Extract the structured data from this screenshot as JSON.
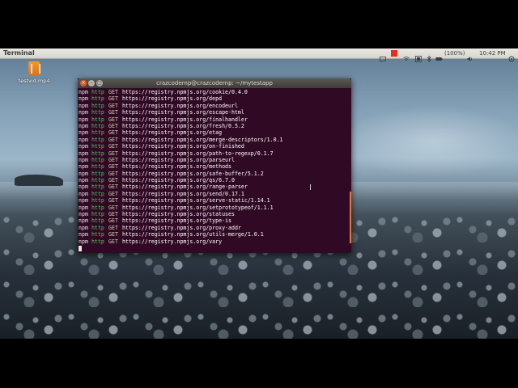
{
  "topbar": {
    "app_name": "Terminal",
    "battery": "(100%)",
    "time": "10:42 PM"
  },
  "desktop": {
    "icon_label": "testvid.mp4"
  },
  "terminal": {
    "title": "crazcodernp@crazcodernp: ~/mytestapp",
    "lines": [
      {
        "npm": "npm",
        "http": "http",
        "method": "GET",
        "url": "https://registry.npmjs.org/cookie/0.4.0"
      },
      {
        "npm": "npm",
        "http": "http",
        "method": "GET",
        "url": "https://registry.npmjs.org/depd"
      },
      {
        "npm": "npm",
        "http": "http",
        "method": "GET",
        "url": "https://registry.npmjs.org/encodeurl"
      },
      {
        "npm": "npm",
        "http": "http",
        "method": "GET",
        "url": "https://registry.npmjs.org/escape-html"
      },
      {
        "npm": "npm",
        "http": "http",
        "method": "GET",
        "url": "https://registry.npmjs.org/finalhandler"
      },
      {
        "npm": "npm",
        "http": "http",
        "method": "GET",
        "url": "https://registry.npmjs.org/fresh/0.5.2"
      },
      {
        "npm": "npm",
        "http": "http",
        "method": "GET",
        "url": "https://registry.npmjs.org/etag"
      },
      {
        "npm": "npm",
        "http": "http",
        "method": "GET",
        "url": "https://registry.npmjs.org/merge-descriptors/1.0.1"
      },
      {
        "npm": "npm",
        "http": "http",
        "method": "GET",
        "url": "https://registry.npmjs.org/on-finished"
      },
      {
        "npm": "npm",
        "http": "http",
        "method": "GET",
        "url": "https://registry.npmjs.org/path-to-regexp/0.1.7"
      },
      {
        "npm": "npm",
        "http": "http",
        "method": "GET",
        "url": "https://registry.npmjs.org/parseurl"
      },
      {
        "npm": "npm",
        "http": "http",
        "method": "GET",
        "url": "https://registry.npmjs.org/methods"
      },
      {
        "npm": "npm",
        "http": "http",
        "method": "GET",
        "url": "https://registry.npmjs.org/safe-buffer/5.1.2"
      },
      {
        "npm": "npm",
        "http": "http",
        "method": "GET",
        "url": "https://registry.npmjs.org/qs/6.7.0"
      },
      {
        "npm": "npm",
        "http": "http",
        "method": "GET",
        "url": "https://registry.npmjs.org/range-parser"
      },
      {
        "npm": "npm",
        "http": "http",
        "method": "GET",
        "url": "https://registry.npmjs.org/send/0.17.1"
      },
      {
        "npm": "npm",
        "http": "http",
        "method": "GET",
        "url": "https://registry.npmjs.org/serve-static/1.14.1"
      },
      {
        "npm": "npm",
        "http": "http",
        "method": "GET",
        "url": "https://registry.npmjs.org/setprototypeof/1.1.1"
      },
      {
        "npm": "npm",
        "http": "http",
        "method": "GET",
        "url": "https://registry.npmjs.org/statuses"
      },
      {
        "npm": "npm",
        "http": "http",
        "method": "GET",
        "url": "https://registry.npmjs.org/type-is"
      },
      {
        "npm": "npm",
        "http": "http",
        "method": "GET",
        "url": "https://registry.npmjs.org/proxy-addr"
      },
      {
        "npm": "npm",
        "http": "http",
        "method": "GET",
        "url": "https://registry.npmjs.org/utils-merge/1.0.1"
      },
      {
        "npm": "npm",
        "http": "http",
        "method": "GET",
        "url": "https://registry.npmjs.org/vary"
      }
    ]
  },
  "colors": {
    "terminal_bg": "#300a24",
    "http_green": "#4ec95f",
    "panel_bg": "#dfdbd2"
  },
  "icons": [
    "close-icon",
    "minimize-icon",
    "maximize-icon",
    "wifi-icon",
    "bluetooth-icon",
    "battery-icon",
    "volume-icon",
    "settings-icon",
    "record-icon",
    "keyboard-icon"
  ]
}
